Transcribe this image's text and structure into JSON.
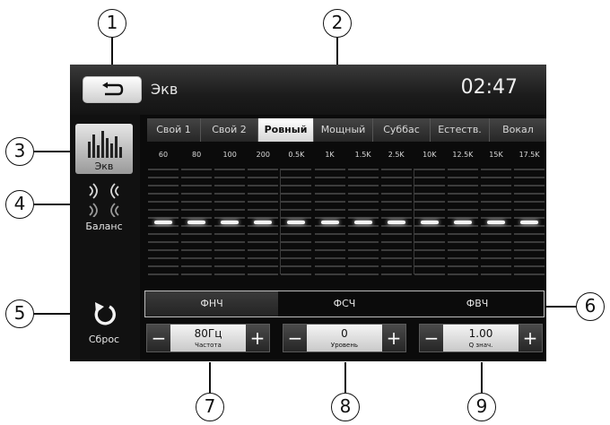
{
  "callouts": [
    "1",
    "2",
    "3",
    "4",
    "5",
    "6",
    "7",
    "8",
    "9"
  ],
  "header": {
    "title": "Экв",
    "time": "02:47"
  },
  "sidebar": {
    "eq_label": "Экв",
    "balance_label": "Баланс",
    "reset_label": "Сброс"
  },
  "presets": [
    "Свой 1",
    "Свой 2",
    "Ровный",
    "Мощный",
    "Суббас",
    "Естеств.",
    "Вокал"
  ],
  "active_preset": "Ровный",
  "bands": [
    {
      "freq": "60",
      "level": 0
    },
    {
      "freq": "80",
      "level": 0
    },
    {
      "freq": "100",
      "level": 0
    },
    {
      "freq": "200",
      "level": 0
    },
    {
      "freq": "0.5K",
      "level": 0
    },
    {
      "freq": "1K",
      "level": 0
    },
    {
      "freq": "1.5K",
      "level": 0
    },
    {
      "freq": "2.5K",
      "level": 0
    },
    {
      "freq": "10K",
      "level": 0
    },
    {
      "freq": "12.5K",
      "level": 0
    },
    {
      "freq": "15K",
      "level": 0
    },
    {
      "freq": "17.5K",
      "level": 0
    }
  ],
  "filters": [
    "ФНЧ",
    "ФСЧ",
    "ФВЧ"
  ],
  "steppers": [
    {
      "value": "80Гц",
      "label": "Частота",
      "minus": "−",
      "plus": "+"
    },
    {
      "value": "0",
      "label": "Уровень",
      "minus": "−",
      "plus": "+"
    },
    {
      "value": "1.00",
      "label": "Q знач.",
      "minus": "−",
      "plus": "+"
    }
  ],
  "icons": {
    "back": "back-arrow-icon",
    "eq": "equalizer-bars-icon",
    "balance": "speaker-balance-icon",
    "reset": "reset-arrow-icon"
  },
  "colors": {
    "screen_bg": "#0b0b0b",
    "active_tab": "#ffffff",
    "text": "#e6e6e6",
    "knob": "#f4f4f4"
  }
}
